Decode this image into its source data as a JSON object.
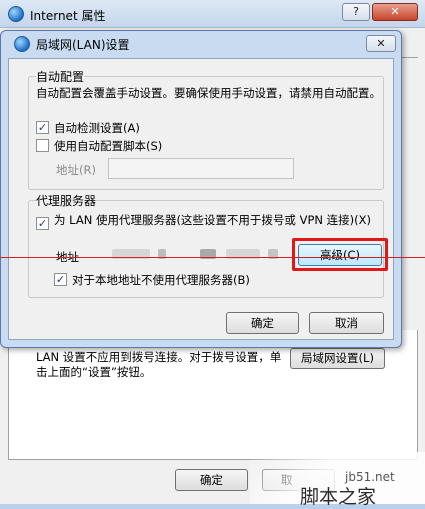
{
  "outer_window": {
    "title": "Internet 属性",
    "help_label": "?",
    "close_label": "✕",
    "lan_note": "LAN 设置不应用到拨号连接。对于拨号设置，单击上面的“设置”按钮。",
    "lan_settings_label": "局域网设置(L)",
    "ok_label": "确定",
    "cancel_label": "取"
  },
  "lan_dialog": {
    "title": "局域网(LAN)设置",
    "close_label": "✕",
    "auto_config": {
      "title": "自动配置",
      "description": "自动配置会覆盖手动设置。要确保使用手动设置，请禁用自动配置。",
      "auto_detect": {
        "label": "自动检测设置(A)",
        "checked": true
      },
      "use_script": {
        "label": "使用自动配置脚本(S)",
        "checked": false
      },
      "address_label": "地址(R)",
      "address_value": ""
    },
    "proxy": {
      "title": "代理服务器",
      "use_proxy": {
        "label": "为 LAN 使用代理服务器(这些设置不用于拨号或 VPN 连接)(X)",
        "checked": true
      },
      "address_label": "地址",
      "advanced_label": "高级(C)",
      "bypass_local": {
        "label": "对于本地地址不使用代理服务器(B)",
        "checked": true
      }
    },
    "ok_label": "确定",
    "cancel_label": "取消"
  },
  "watermark": {
    "url": "jb51.net",
    "logo": "脚本之家"
  },
  "colors": {
    "highlight": "#e01818",
    "dialog_frame": "#c9dbf0"
  }
}
